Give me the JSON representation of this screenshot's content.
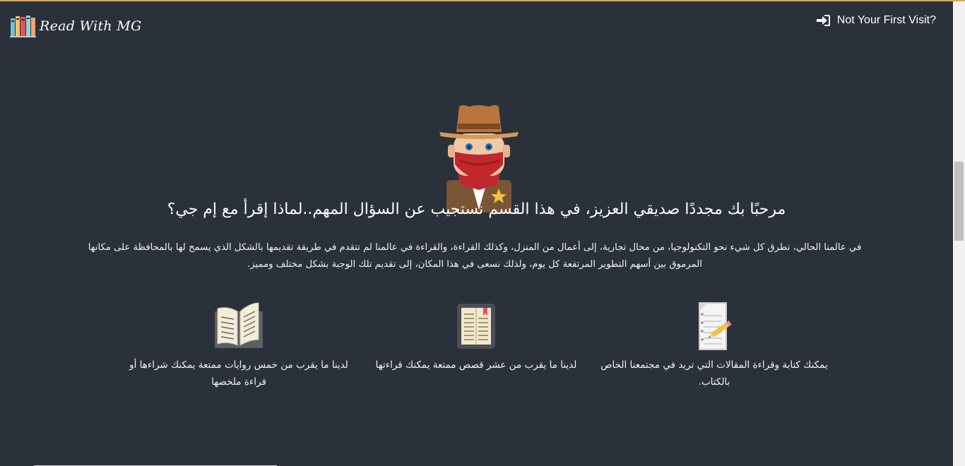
{
  "header": {
    "brand_name": "Read With MG",
    "login_label": "Not Your First Visit?"
  },
  "hero": {
    "title": "مرحبًا بك مجددًا صديقي العزيز، في هذا القسم نستجيب عن السؤال المهم..لماذا إقرأ مع إم جي؟",
    "paragraph": "في عالمنا الحالي، تطرق كل شيء نحو التكنولوجيا، من محال تجارية، إلى أعمال من المنزل، وكذلك القراءة، والقراءة في عالمنا لم تتقدم في طريقة تقديمها بالشكل الذي يسمح لها بالمحافظة على مكانها المرموق بين أسهم التطوير المرتفعة كل يوم، ولذلك نسعى في هذا المكان، إلى تقديم تلك الوجبة بشكل مختلف ومميز."
  },
  "features": [
    {
      "icon": "writing-paper-icon",
      "text": "يمكنك كتابة وقراءة المقالات التي تريد في مجتمعنا الخاص بالكتاب."
    },
    {
      "icon": "ebook-reader-icon",
      "text": "لدينا ما يقرب من عشر قصص ممتعة يمكنك قراءتها"
    },
    {
      "icon": "open-book-icon",
      "text": "لدينا ما يقرب من خمس روايات ممتعة يمكنك شراءها أو قراءة ملخصها"
    }
  ],
  "colors": {
    "background": "#2b313b",
    "accent": "#e0a64a",
    "text": "#ffffff"
  }
}
